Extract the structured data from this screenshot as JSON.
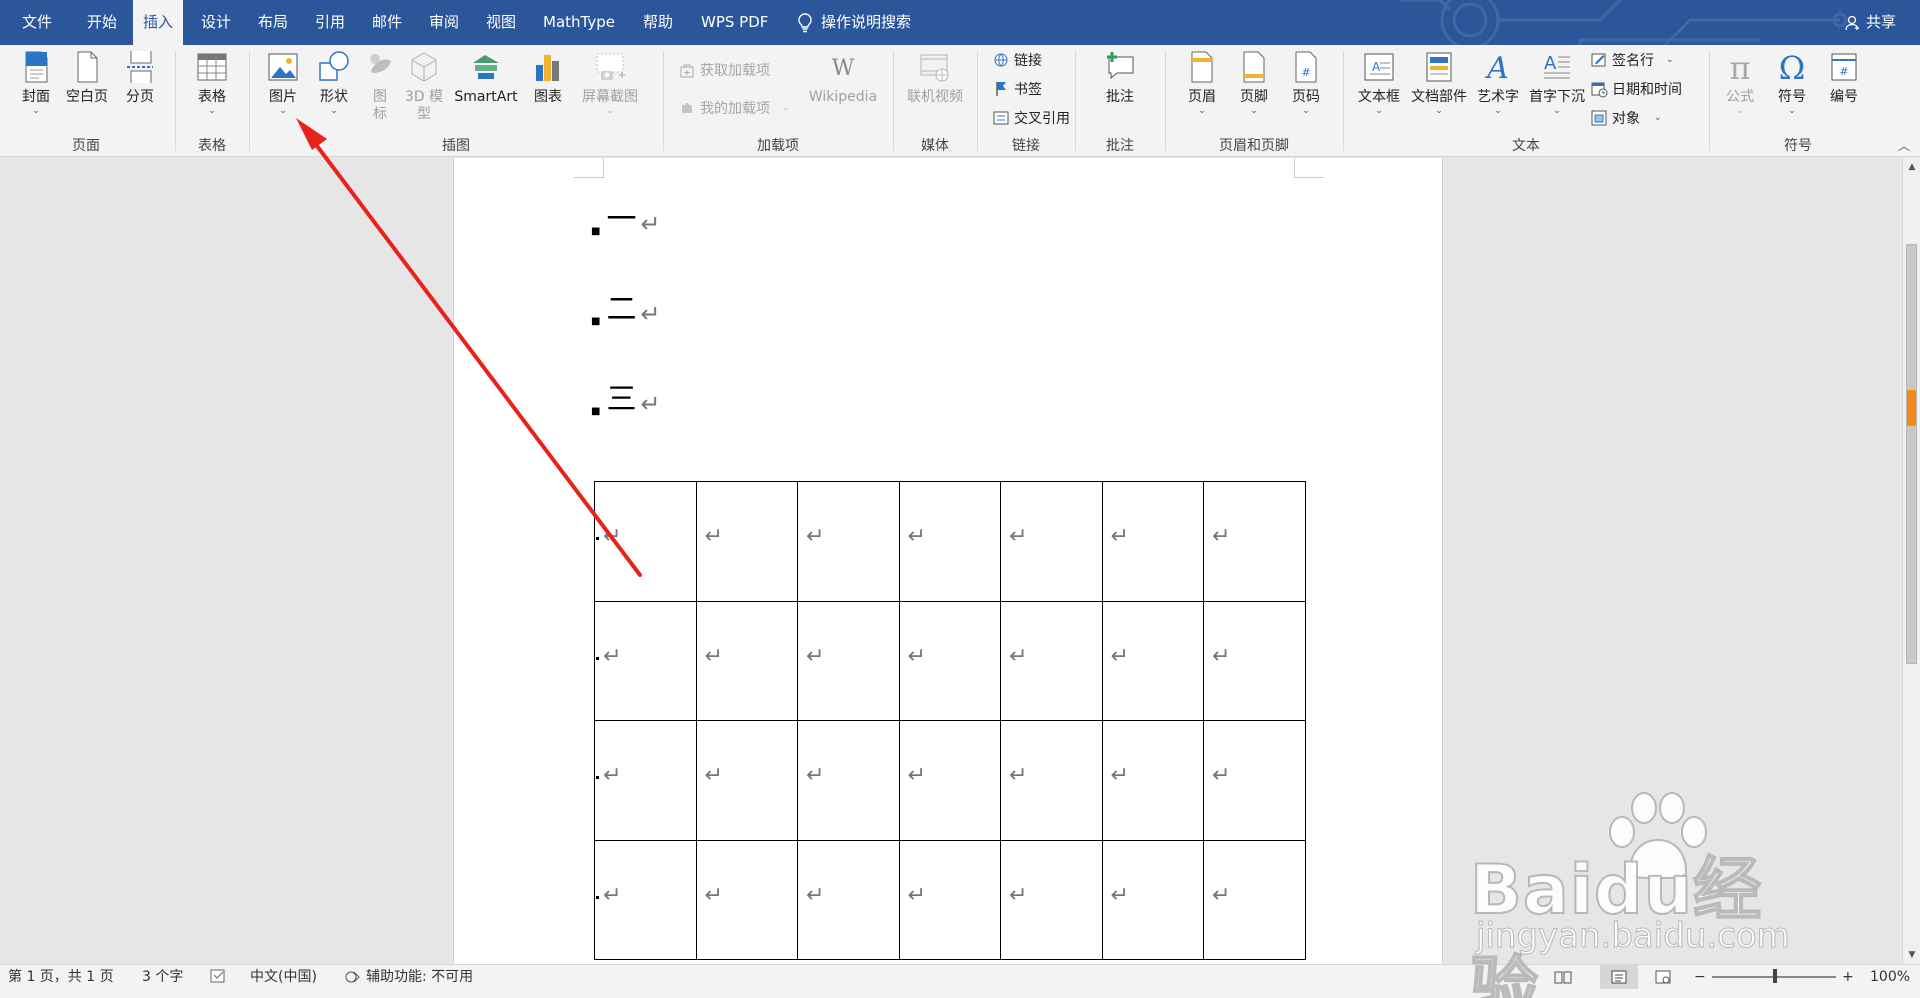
{
  "tabs": [
    "文件",
    "开始",
    "插入",
    "设计",
    "布局",
    "引用",
    "邮件",
    "审阅",
    "视图",
    "MathType",
    "帮助",
    "WPS PDF"
  ],
  "active_tab": "插入",
  "tell_me": "操作说明搜索",
  "share": "共享",
  "ribbon": {
    "groups": {
      "pages": "页面",
      "tables": "表格",
      "illustrations": "插图",
      "addins": "加载项",
      "media": "媒体",
      "links": "链接",
      "comments": "批注",
      "header_footer": "页眉和页脚",
      "text": "文本",
      "symbols": "符号"
    },
    "buttons": {
      "cover": "封面",
      "blank_page": "空白页",
      "page_break": "分页",
      "table": "表格",
      "picture": "图片",
      "shapes": "形状",
      "icons_1": "图",
      "icons_2": "标",
      "model3d_1": "3D 模",
      "model3d_2": "型",
      "smartart": "SmartArt",
      "chart": "图表",
      "screenshot": "屏幕截图",
      "get_addins": "获取加载项",
      "my_addins": "我的加载项",
      "wikipedia": "Wikipedia",
      "online_video": "联机视频",
      "link": "链接",
      "bookmark": "书签",
      "cross_ref": "交叉引用",
      "comment": "批注",
      "header": "页眉",
      "footer": "页脚",
      "page_number": "页码",
      "textbox": "文本框",
      "quick_parts": "文档部件",
      "wordart": "艺术字",
      "dropcap": "首字下沉",
      "signature": "签名行",
      "datetime": "日期和时间",
      "object": "对象",
      "equation": "公式",
      "symbol": "符号",
      "numbering": "编号"
    }
  },
  "document": {
    "paragraphs": [
      "一",
      "二",
      "三"
    ],
    "paragraph_mark": "↵",
    "table": {
      "rows": 4,
      "cols": 7
    }
  },
  "status": {
    "page": "第 1 页，共 1 页",
    "words": "3 个字",
    "language": "中文(中国)",
    "accessibility": "辅助功能: 不可用",
    "zoom": "100%",
    "zoom_minus": "−",
    "zoom_plus": "+"
  },
  "watermark": {
    "main": "Baidu经验",
    "sub": "jingyan.baidu.com"
  },
  "colors": {
    "accent": "#2b579a",
    "ribbon_bg": "#f3f3f3",
    "annotation_arrow": "#e8231b"
  }
}
